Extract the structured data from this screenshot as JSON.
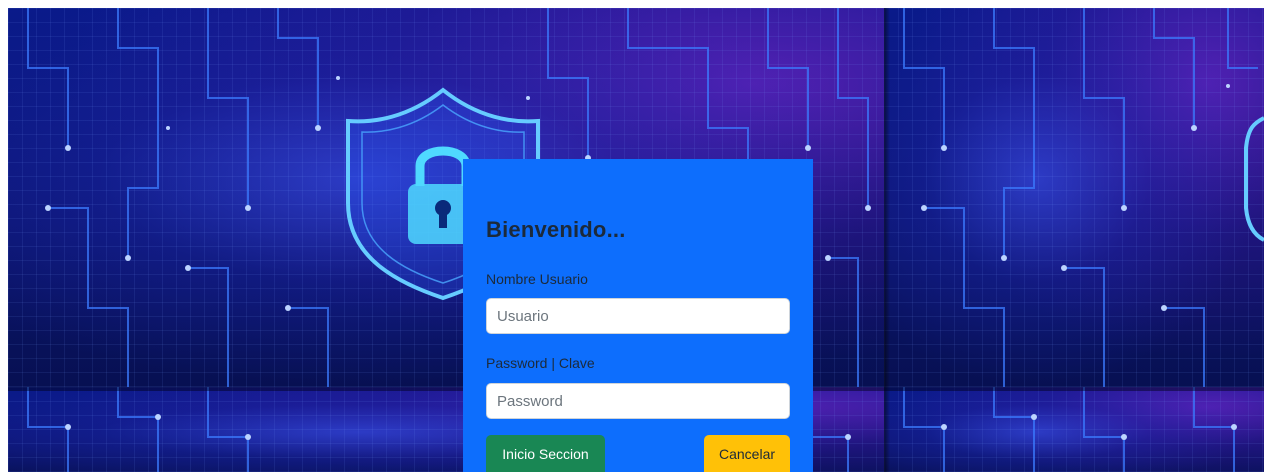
{
  "login": {
    "title": "Bienvenido...",
    "username_label": "Nombre Usuario",
    "username_placeholder": "Usuario",
    "username_value": "",
    "password_label": "Password | Clave",
    "password_placeholder": "Password",
    "password_value": "",
    "submit_label": "Inicio Seccion",
    "cancel_label": "Cancelar"
  },
  "theme": {
    "card_color": "#0d6efd",
    "submit_color": "#198754",
    "cancel_color": "#ffc107"
  },
  "background": {
    "icon": "shield-lock-icon"
  }
}
